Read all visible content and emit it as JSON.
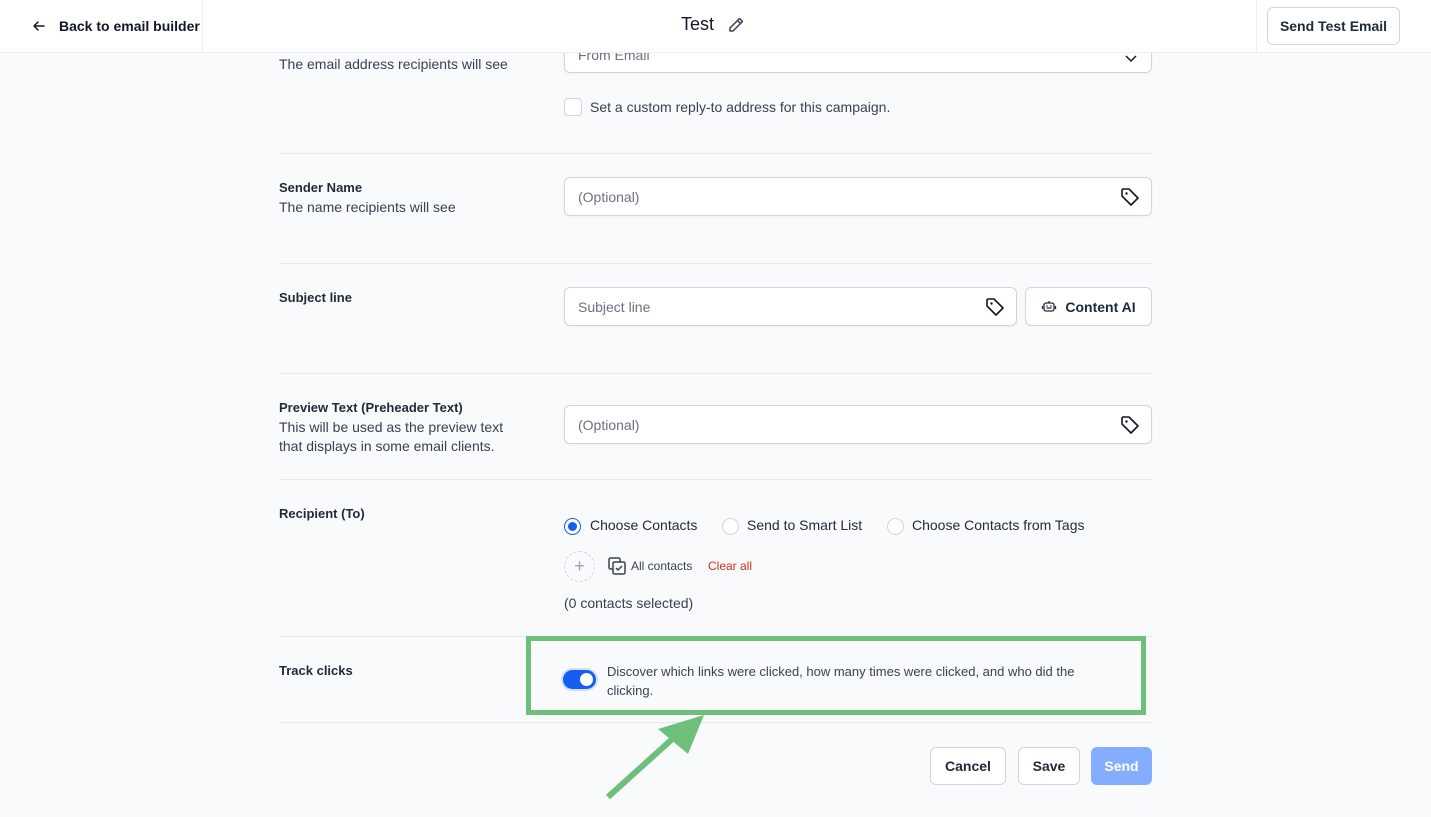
{
  "header": {
    "back_label": "Back to email builder",
    "title": "Test",
    "send_test_label": "Send Test Email"
  },
  "from_email": {
    "description": "The email address recipients will see",
    "placeholder": "From Email",
    "reply_to_label": "Set a custom reply-to address for this campaign.",
    "reply_to_checked": false
  },
  "sender_name": {
    "label": "Sender Name",
    "description": "The name recipients will see",
    "placeholder": "(Optional)"
  },
  "subject": {
    "label": "Subject line",
    "placeholder": "Subject line",
    "content_ai_label": "Content AI"
  },
  "preview_text": {
    "label": "Preview Text (Preheader Text)",
    "description_line1": "This will be used as the preview text",
    "description_line2": "that displays in some email clients.",
    "placeholder": "(Optional)"
  },
  "recipient": {
    "label": "Recipient (To)",
    "options": [
      {
        "label": "Choose Contacts",
        "selected": true
      },
      {
        "label": "Send to Smart List",
        "selected": false
      },
      {
        "label": "Choose Contacts from Tags",
        "selected": false
      }
    ],
    "all_contacts_label": "All contacts",
    "clear_all_label": "Clear all",
    "selected_count_text": "(0 contacts selected)"
  },
  "track_clicks": {
    "label": "Track clicks",
    "enabled": true,
    "description_line1": "Discover which links were clicked, how many times were clicked, and who did the",
    "description_line2": "clicking."
  },
  "footer": {
    "cancel_label": "Cancel",
    "save_label": "Save",
    "send_label": "Send"
  },
  "colors": {
    "primary": "#155eef",
    "primary_disabled": "#84adff",
    "danger": "#d92d20",
    "annotation": "#6dbf7a"
  }
}
